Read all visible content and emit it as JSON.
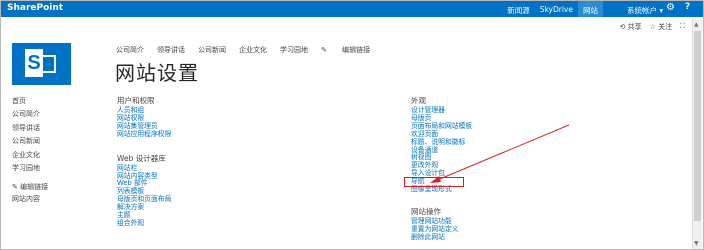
{
  "suite_bar": {
    "brand": "SharePoint",
    "links": [
      "新闻源",
      "SkyDrive",
      "网站"
    ],
    "active_link": "网站",
    "account": "系统帐户 ▾",
    "help": "?"
  },
  "action_bar": {
    "share": "共享",
    "follow": "关注"
  },
  "top_nav": {
    "items": [
      "公司简介",
      "领导讲话",
      "公司新闻",
      "企业文化",
      "学习园地"
    ],
    "edit_links": "编辑链接"
  },
  "page_title": "网站设置",
  "left_nav": {
    "items": [
      "首页",
      "公司简介",
      "领导讲话",
      "公司新闻",
      "企业文化",
      "学习园地"
    ],
    "edit_links": "编辑链接",
    "site_contents": "网站内容"
  },
  "sections": {
    "users_permissions": {
      "heading": "用户和权限",
      "links": [
        "人员和组",
        "网站权限",
        "网站集管理员",
        "网站应用程序权限"
      ]
    },
    "web_designer": {
      "heading": "Web 设计器库",
      "links": [
        "网站栏",
        "网站内容类型",
        "Web 部件",
        "列表模板",
        "母版页和页面布局",
        "解决方案",
        "主题",
        "组合外观"
      ]
    },
    "look_and_feel": {
      "heading": "外观",
      "links": [
        "设计管理器",
        "母版页",
        "页面布局和网站模板",
        "欢迎页面",
        "标题、说明和徽标",
        "设备通道",
        "树视图",
        "更改外观",
        "导入设计包",
        "导航",
        "图像呈现形式"
      ]
    },
    "site_actions": {
      "heading": "网站操作",
      "links": [
        "管理网站功能",
        "重置为网站定义",
        "删除此网站"
      ]
    }
  },
  "annotation": {
    "highlighted_item": "导航",
    "highlight_color": "#e11b22"
  },
  "colors": {
    "suite_blue": "#0072c6",
    "link_blue": "#0072c6",
    "active_tab": "#2a8dd4"
  }
}
